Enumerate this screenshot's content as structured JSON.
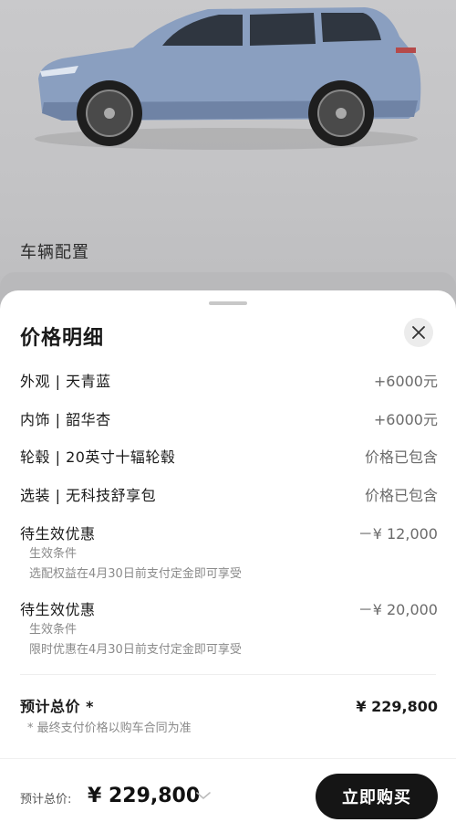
{
  "background": {
    "section_title": "车辆配置",
    "car_image": "blue-suv-side-view"
  },
  "sheet": {
    "title": "价格明细",
    "close_icon": "close-icon",
    "rows": [
      {
        "label": "外观 | 天青蓝",
        "value": "+6000元"
      },
      {
        "label": "内饰 | 韶华杏",
        "value": "+6000元"
      },
      {
        "label": "轮毂 | 20英寸十辐轮毂",
        "value": "价格已包含"
      },
      {
        "label": "选装 | 无科技舒享包",
        "value": "价格已包含"
      }
    ],
    "discounts": [
      {
        "label": "待生效优惠",
        "value": "－¥ 12,000",
        "cond_title": "生效条件",
        "cond_text": "选配权益在4月30日前支付定金即可享受"
      },
      {
        "label": "待生效优惠",
        "value": "－¥ 20,000",
        "cond_title": "生效条件",
        "cond_text": "限时优惠在4月30日前支付定金即可享受"
      }
    ],
    "total": {
      "label": "预计总价 *",
      "value": "¥ 229,800"
    },
    "note": "* 最终支付价格以购车合同为准"
  },
  "footer": {
    "label": "预计总价:",
    "price": "¥ 229,800",
    "buy_label": "立即购买"
  },
  "colors": {
    "backdrop": "#c5c5c7",
    "car_body": "#8a9fc0",
    "button": "#151515"
  }
}
